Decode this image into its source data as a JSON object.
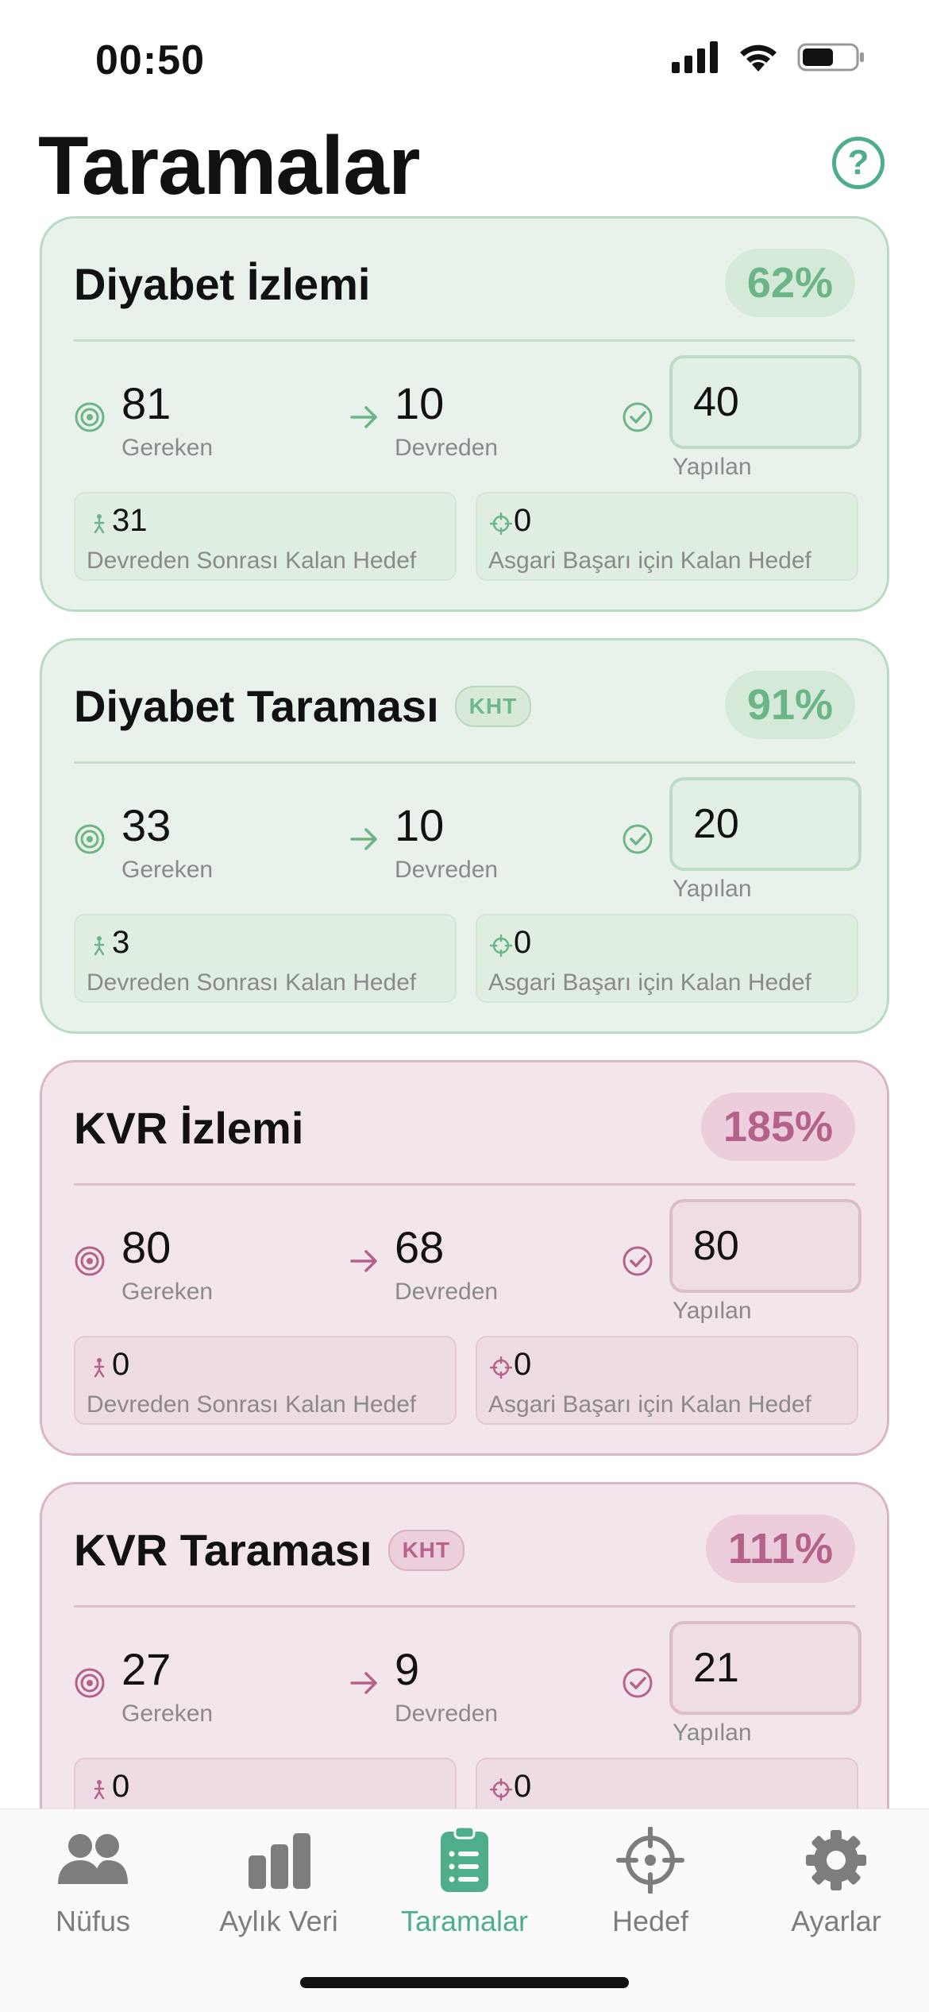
{
  "status": {
    "time": "00:50"
  },
  "header": {
    "title": "Taramalar",
    "help_icon": "question-circle-icon"
  },
  "labels": {
    "gereken": "Gereken",
    "devreden": "Devreden",
    "yapilan": "Yapılan",
    "devreden_sonrasi": "Devreden Sonrası Kalan Hedef",
    "asgari": "Asgari Başarı için Kalan Hedef"
  },
  "colors": {
    "green_accent": "#6bb587",
    "pink_accent": "#b4628a",
    "active_tab": "#4fae8a"
  },
  "cards": [
    {
      "title": "Diyabet İzlemi",
      "badge": "",
      "percent": "62%",
      "theme": "green",
      "gereken": "81",
      "devreden": "10",
      "yapilan": "40",
      "devreden_sonrasi": "31",
      "asgari": "0"
    },
    {
      "title": "Diyabet Taraması",
      "badge": "KHT",
      "percent": "91%",
      "theme": "green",
      "gereken": "33",
      "devreden": "10",
      "yapilan": "20",
      "devreden_sonrasi": "3",
      "asgari": "0"
    },
    {
      "title": "KVR İzlemi",
      "badge": "",
      "percent": "185%",
      "theme": "pink",
      "gereken": "80",
      "devreden": "68",
      "yapilan": "80",
      "devreden_sonrasi": "0",
      "asgari": "0"
    },
    {
      "title": "KVR Taraması",
      "badge": "KHT",
      "percent": "111%",
      "theme": "pink",
      "gereken": "27",
      "devreden": "9",
      "yapilan": "21",
      "devreden_sonrasi": "0",
      "asgari": "0"
    }
  ],
  "tabs": [
    {
      "label": "Nüfus",
      "icon": "people-icon",
      "active": false
    },
    {
      "label": "Aylık Veri",
      "icon": "bar-chart-icon",
      "active": false
    },
    {
      "label": "Taramalar",
      "icon": "clipboard-list-icon",
      "active": true
    },
    {
      "label": "Hedef",
      "icon": "crosshair-icon",
      "active": false
    },
    {
      "label": "Ayarlar",
      "icon": "gear-icon",
      "active": false
    }
  ]
}
